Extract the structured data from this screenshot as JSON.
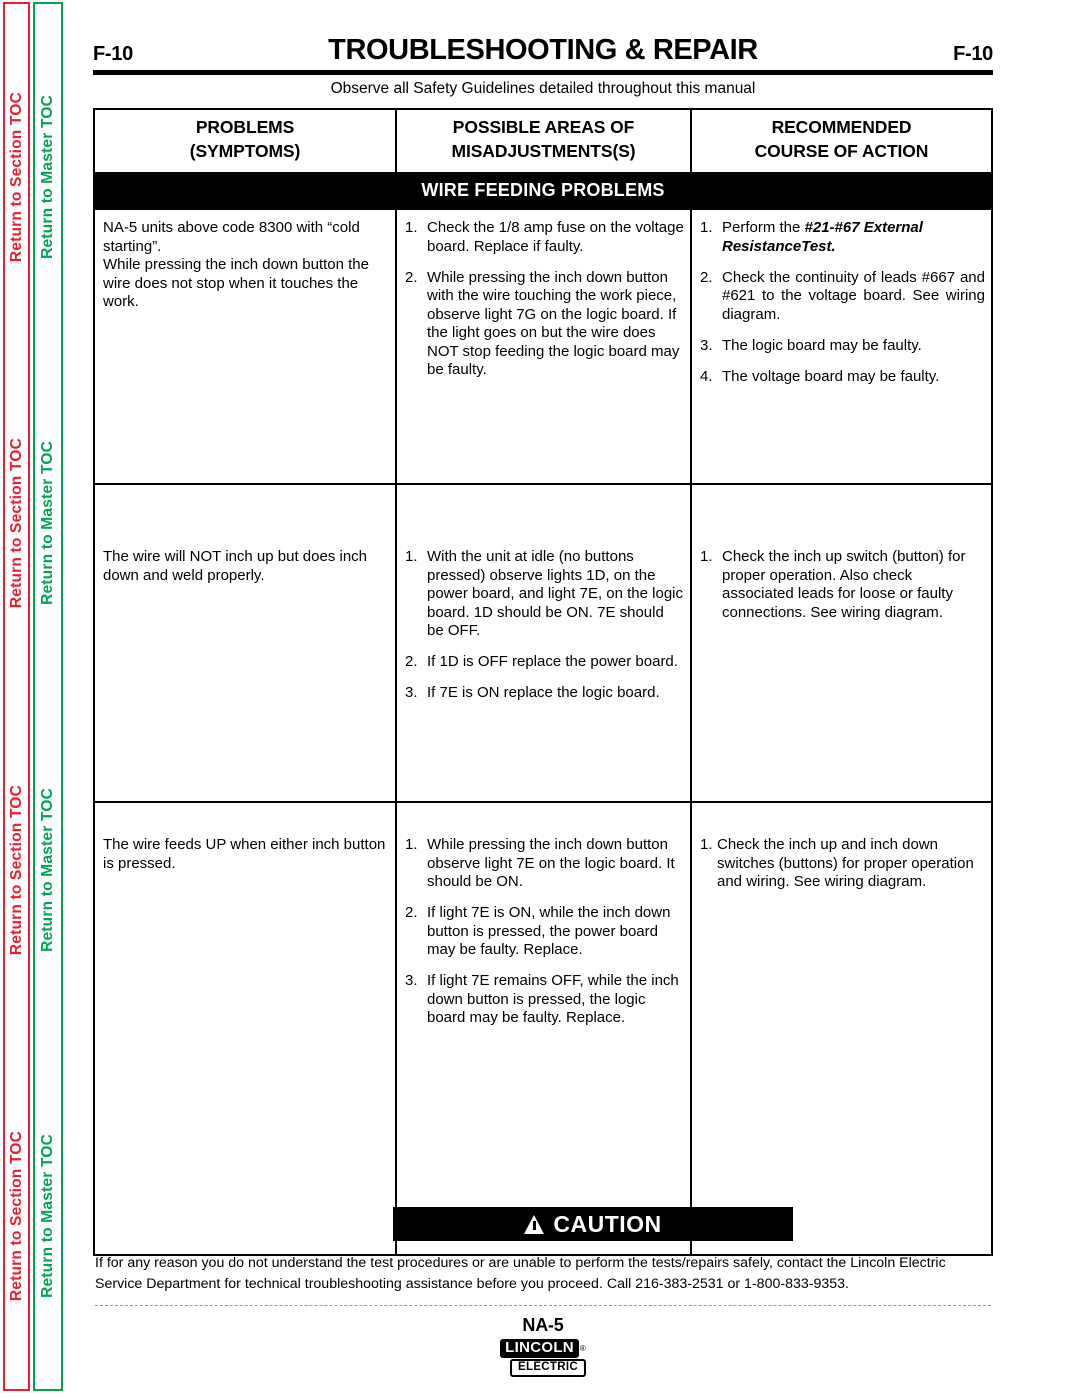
{
  "sidebar": {
    "section_toc_label": "Return to Section TOC",
    "master_toc_label": "Return to Master TOC",
    "section_toc_color": "#ed1c2e",
    "master_toc_color": "#00a550",
    "repeat_count": 4
  },
  "header": {
    "folio_left": "F-10",
    "title": "TROUBLESHOOTING & REPAIR",
    "folio_right": "F-10",
    "observe_note": "Observe all Safety Guidelines detailed throughout this manual"
  },
  "table": {
    "columns": [
      {
        "line1": "PROBLEMS",
        "line2": "(SYMPTOMS)"
      },
      {
        "line1": "POSSIBLE AREAS OF",
        "line2": "MISADJUSTMENTS(S)"
      },
      {
        "line1": "RECOMMENDED",
        "line2": "COURSE OF ACTION"
      }
    ],
    "band_label": "WIRE FEEDING PROBLEMS",
    "rows": [
      {
        "symptom_paragraphs": [
          "NA-5 units above code 8300 with “cold starting”.",
          "While pressing the inch down button the wire does not stop when it touches the work."
        ],
        "misadjustments": [
          {
            "num": "1.",
            "text": "Check the 1/8 amp fuse on the voltage board.  Replace if faulty."
          },
          {
            "num": "2.",
            "text": "While pressing the inch down button with the wire touching the work piece, observe light 7G on the logic board.  If the light goes on but the wire does NOT stop feeding the logic board may be faulty."
          }
        ],
        "actions": [
          {
            "num": "1.",
            "text_plain": "Perform the ",
            "text_emph": "#21-#67 External ResistanceTest."
          },
          {
            "num": "2.",
            "text": "Check the continuity of leads #667 and #621 to the voltage board.  See wiring diagram."
          },
          {
            "num": "3.",
            "text": "The logic board may be faulty."
          },
          {
            "num": "4.",
            "text": "The voltage board may be faulty."
          }
        ]
      },
      {
        "symptom_paragraphs": [
          "The wire will NOT inch up but does inch down and weld properly."
        ],
        "misadjustments": [
          {
            "num": "1.",
            "text": "With the unit at idle (no buttons pressed) observe lights 1D, on the power board, and light 7E, on the logic board.  1D should be ON.  7E should be OFF."
          },
          {
            "num": "2.",
            "text": "If 1D is OFF replace the power board."
          },
          {
            "num": "3.",
            "text": "If 7E is ON replace the logic board."
          }
        ],
        "actions": [
          {
            "num": "1.",
            "text": "Check the inch up switch (button) for proper operation.  Also check associated leads for loose or faulty connections.  See wiring diagram."
          }
        ]
      },
      {
        "symptom_paragraphs": [
          "The wire feeds UP when either inch button is pressed."
        ],
        "misadjustments": [
          {
            "num": "1.",
            "text": "While pressing the inch down button observe light 7E on the logic board.  It should be ON."
          },
          {
            "num": "2.",
            "text": "If light 7E is ON, while the inch down button is pressed, the power board may be faulty. Replace."
          },
          {
            "num": "3.",
            "text": "If light 7E remains OFF,  while the inch down button is pressed, the logic board may be faulty. Replace."
          }
        ],
        "actions": [
          {
            "num": "1.",
            "text": "Check the inch up and inch down switches (buttons) for proper operation and wiring.  See wiring diagram."
          }
        ]
      }
    ]
  },
  "caution": {
    "label": "CAUTION",
    "body": "If for any reason you do not understand the test procedures or are unable to perform the tests/repairs safely, contact the Lincoln Electric Service Department for technical troubleshooting assistance before you proceed. Call 216-383-2531 or 1-800-833-9353."
  },
  "footer": {
    "model": "NA-5",
    "logo_primary": "LINCOLN",
    "logo_registered": "®",
    "logo_secondary": "ELECTRIC"
  }
}
